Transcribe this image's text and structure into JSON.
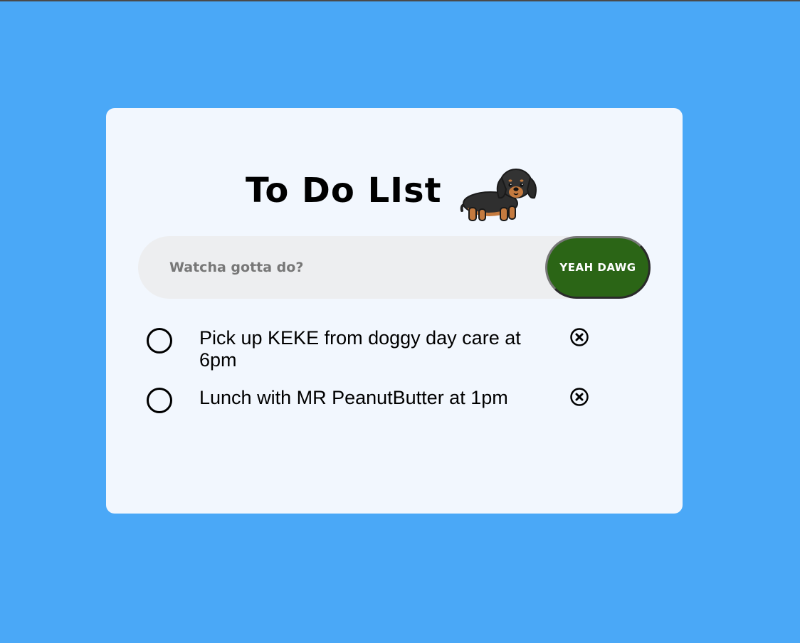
{
  "header": {
    "title": "To Do LIst"
  },
  "new_task": {
    "placeholder": "Watcha gotta do?",
    "value": "",
    "button_label": "YEAH DAWG"
  },
  "tasks": [
    {
      "text": "Pick up KEKE from doggy day care at 6pm",
      "done": false
    },
    {
      "text": "Lunch with MR PeanutButter at 1pm",
      "done": false
    }
  ],
  "icons": {
    "mascot": "dachshund-icon",
    "task_toggle": "circle-checkbox-icon",
    "task_delete": "circle-x-icon"
  },
  "colors": {
    "background": "#4aa8f7",
    "card": "#f2f7fe",
    "input": "#edeef0",
    "button": "#2b6516"
  }
}
